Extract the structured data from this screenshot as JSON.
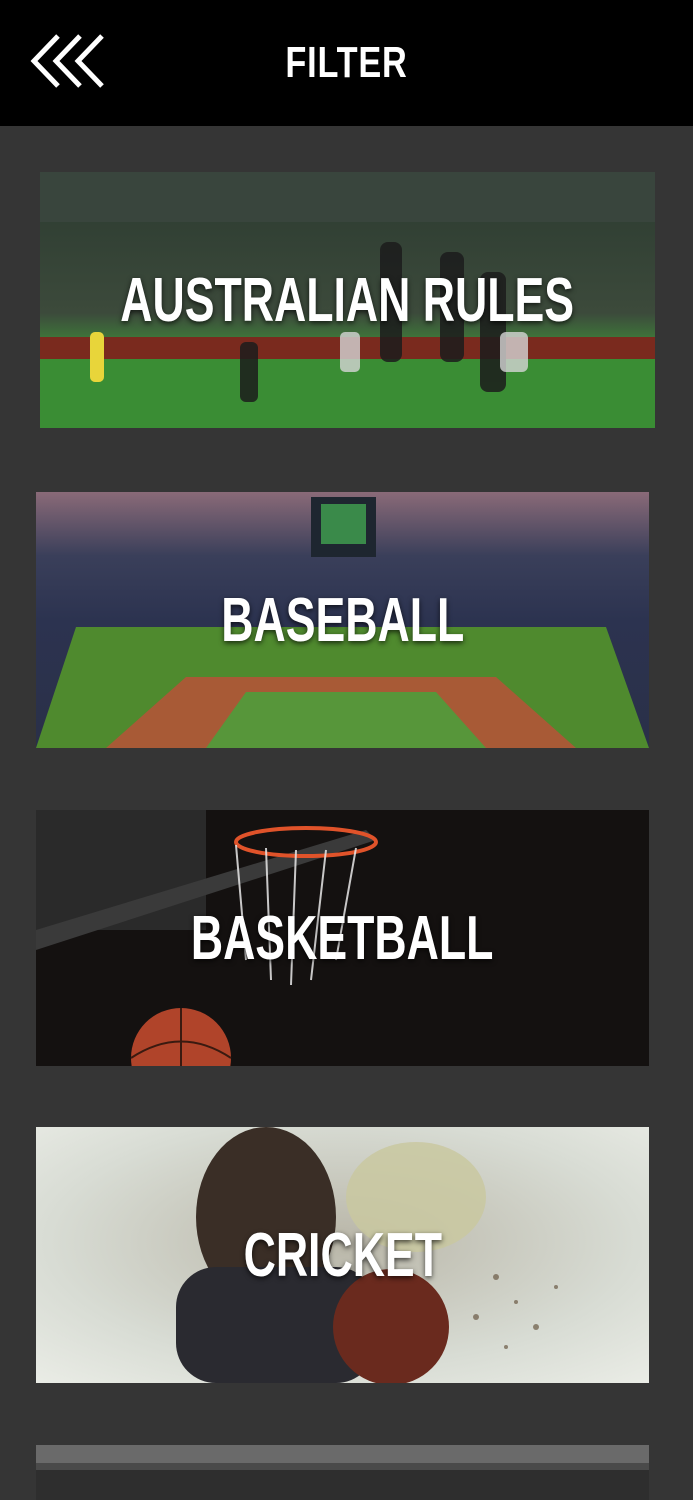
{
  "header": {
    "title": "FILTER",
    "back_icon": "double-chevron-left-icon"
  },
  "sports": [
    {
      "label": "AUSTRALIAN RULES"
    },
    {
      "label": "BASEBALL"
    },
    {
      "label": "BASKETBALL"
    },
    {
      "label": "CRICKET"
    },
    {
      "label": ""
    }
  ]
}
